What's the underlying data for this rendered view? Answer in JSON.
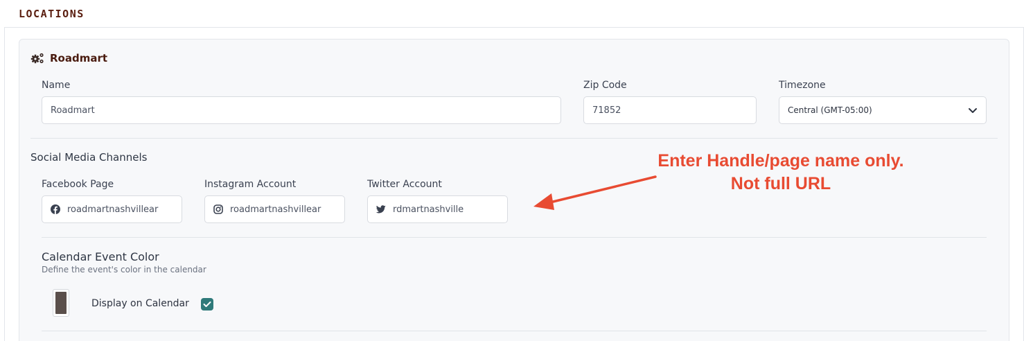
{
  "section": {
    "title": "LOCATIONS"
  },
  "location": {
    "title": "Roadmart",
    "icon": "gears-icon",
    "name_label": "Name",
    "name_value": "Roadmart",
    "zip_label": "Zip Code",
    "zip_value": "71852",
    "timezone_label": "Timezone",
    "timezone_value": "Central (GMT-05:00)"
  },
  "social": {
    "heading": "Social Media Channels",
    "facebook_label": "Facebook Page",
    "facebook_value": "roadmartnashvillear",
    "instagram_label": "Instagram Account",
    "instagram_value": "roadmartnashvillear",
    "twitter_label": "Twitter Account",
    "twitter_value": "rdmartnashville"
  },
  "annotation": {
    "line1": "Enter Handle/page name only.",
    "line2": "Not full URL",
    "color": "#e84b32"
  },
  "calendar": {
    "title": "Calendar Event Color",
    "description": "Define the event's color in the calendar",
    "swatch_color": "#5a4f4b",
    "display_label": "Display on Calendar",
    "display_checked": true,
    "checkbox_color": "#2f7a7a"
  },
  "colors": {
    "brand_dark": "#5a1e10",
    "card_bg": "#f7f8fa"
  }
}
